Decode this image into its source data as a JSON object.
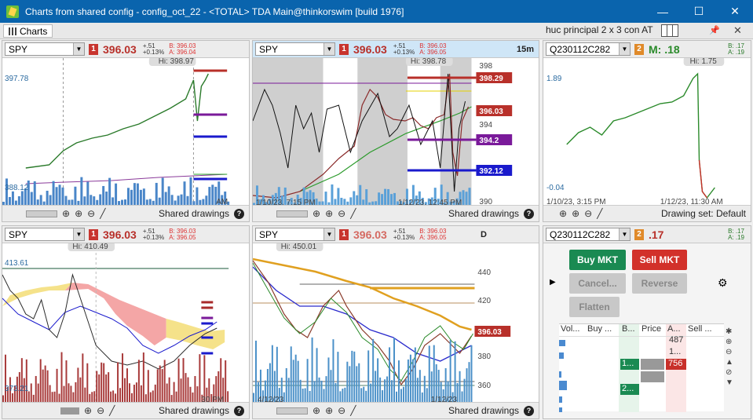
{
  "window": {
    "title": "Charts from shared config - config_oct_22 - <TOTAL> TDA Main@thinkorswim [build 1976]",
    "minimize": "—",
    "maximize": "☐",
    "close": "✕"
  },
  "toolbar": {
    "charts_tab": "Charts",
    "grid_name": "huc principal 2 x 3 con AT"
  },
  "panels": {
    "p1": {
      "symbol": "SPY",
      "badge": "1",
      "price": "396.03",
      "chg1": "+.51",
      "chg2": "+0.13%",
      "bid": "B: 396.03",
      "ask": "A: 396.04",
      "hi": "Hi: 398.97",
      "lbl_top": "397.78",
      "lbl_bot": "388.12",
      "lbl_am": "AM",
      "footer": "Shared drawings"
    },
    "p2": {
      "symbol": "SPY",
      "badge": "1",
      "price": "396.03",
      "chg1": "+.51",
      "chg2": "+0.13%",
      "bid": "B: 396.03",
      "ask": "A: 396.05",
      "timeframe": "15m",
      "hi": "Hi: 398.78",
      "tags": [
        "398.29",
        "396.03",
        "394.2",
        "392.12"
      ],
      "axis": [
        "398",
        "396",
        "394",
        "390"
      ],
      "date1": "1/10/23, 7:15 PM",
      "date2": "1/12/23, 12:45 PM",
      "footer": "Shared drawings"
    },
    "p3": {
      "symbol": "Q230112C282",
      "badge": "2",
      "mark": "M: .18",
      "bid": "B: .17",
      "ask": "A: .19",
      "hi": "Hi: 1.75",
      "lbl_top": "1.89",
      "lbl_bot": "-0.04",
      "date1": "1/10/23, 3:15 PM",
      "date2": "1/12/23, 11:30 AM",
      "footer": "Drawing set: Default"
    },
    "p4": {
      "symbol": "SPY",
      "badge": "1",
      "price": "396.03",
      "chg1": "+.51",
      "chg2": "+0.13%",
      "bid": "B: 396.03",
      "ask": "A: 396.05",
      "hi": "Hi: 410.49",
      "lbl_top": "413.61",
      "lbl_bot": "373.21",
      "lbl_pm": "30 PM",
      "footer": "Shared drawings"
    },
    "p5": {
      "symbol": "SPY",
      "badge": "1",
      "price": "396.03",
      "chg1": "+.51",
      "chg2": "+0.13%",
      "bid": "B: 396.03",
      "ask": "A: 396.05",
      "timeframe": "D",
      "hi": "Hi: 450.01",
      "tag": "396.03",
      "axis": [
        "440",
        "420",
        "400",
        "380",
        "360"
      ],
      "date1": "4/12/23",
      "date2": "1/12/23",
      "footer": "Shared drawings"
    },
    "p6": {
      "symbol": "Q230112C282",
      "badge": "2",
      "price": ".17",
      "bid": "B: .17",
      "ask": "A: .19",
      "buy": "Buy MKT",
      "sell": "Sell MKT",
      "cancel": "Cancel...",
      "reverse": "Reverse",
      "flatten": "Flatten",
      "columns": [
        "Vol...",
        "Buy ...",
        "B...",
        "Price",
        "A...",
        "Sell ..."
      ],
      "cells": [
        "487",
        "1...",
        "756",
        "1...",
        "2..."
      ]
    }
  },
  "colors": {
    "accent_blue": "#0a64ad",
    "buy": "#1a8a52",
    "sell": "#d2312a",
    "price_red": "#b8302a"
  }
}
